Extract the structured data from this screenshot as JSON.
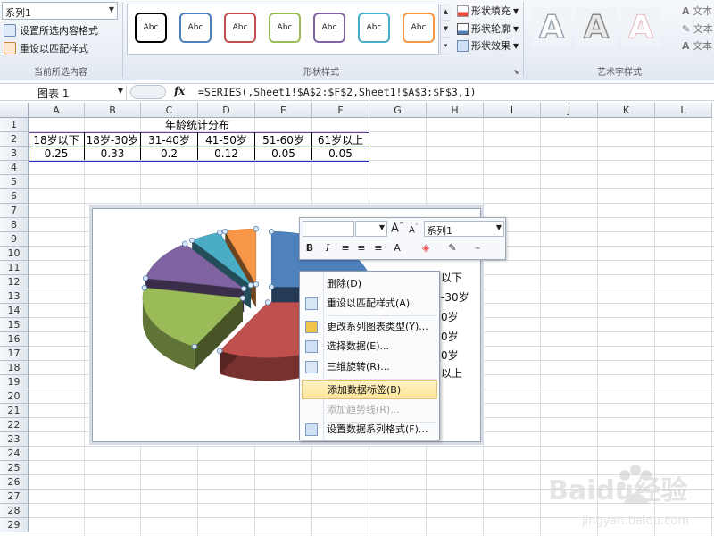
{
  "ribbon": {
    "series_select": "系列1",
    "cmd_format_selection": "设置所选内容格式",
    "cmd_reset_style": "重设以匹配样式",
    "group_current_selection": "当前所选内容",
    "group_shape_styles": "形状样式",
    "group_wordart_styles": "艺术字样式",
    "swatch_label": "Abc",
    "swatches": [
      "#000000",
      "#4f81bd",
      "#c0504d",
      "#9bbb59",
      "#8064a2",
      "#4bacc6",
      "#f79646"
    ],
    "shape_fill": "形状填充",
    "shape_outline": "形状轮廓",
    "shape_effects": "形状效果",
    "wordart_glyph": "A",
    "text_fill": "文本",
    "text_outline": "文本",
    "text_effects": "文本"
  },
  "formula_bar": {
    "name_box": "图表 1",
    "fx": "fx",
    "formula": "=SERIES(,Sheet1!$A$2:$F$2,Sheet1!$A$3:$F$3,1)"
  },
  "sheet": {
    "columns": [
      "A",
      "B",
      "C",
      "D",
      "E",
      "F",
      "G",
      "H",
      "I",
      "J",
      "K",
      "L"
    ],
    "rows": [
      "1",
      "2",
      "3",
      "4",
      "5",
      "6",
      "7",
      "8",
      "9",
      "10",
      "11",
      "12",
      "13",
      "14",
      "15",
      "16",
      "17",
      "18",
      "19",
      "20",
      "21",
      "22",
      "23",
      "24",
      "25",
      "26",
      "27",
      "28",
      "29"
    ],
    "title": "年龄统计分布",
    "headers": [
      "18岁以下",
      "18岁-30岁",
      "31-40岁",
      "41-50岁",
      "51-60岁",
      "61岁以上"
    ],
    "values": [
      "0.25",
      "0.33",
      "0.2",
      "0.12",
      "0.05",
      "0.05"
    ]
  },
  "chart": {
    "slices": [
      {
        "label": "18岁以下",
        "value": 0.25,
        "color": "#4f81bd"
      },
      {
        "label": "18岁-30岁",
        "value": 0.33,
        "color": "#c0504d"
      },
      {
        "label": "31-40岁",
        "value": 0.2,
        "color": "#9bbb59"
      },
      {
        "label": "41-50岁",
        "value": 0.12,
        "color": "#8064a2"
      },
      {
        "label": "51-60岁",
        "value": 0.05,
        "color": "#4bacc6"
      },
      {
        "label": "61岁以上",
        "value": 0.05,
        "color": "#f79646"
      }
    ],
    "legend_fragments": [
      "以下",
      "-30岁",
      "0岁",
      "0岁",
      "0岁",
      "以上"
    ]
  },
  "chart_data": {
    "type": "pie",
    "title": "",
    "categories": [
      "18岁以下",
      "18岁-30岁",
      "31-40岁",
      "41-50岁",
      "51-60岁",
      "61岁以上"
    ],
    "values": [
      0.25,
      0.33,
      0.2,
      0.12,
      0.05,
      0.05
    ],
    "legend": "right"
  },
  "mini_toolbar": {
    "font": "",
    "size": "",
    "series": "系列1",
    "grow": "A",
    "shrink": "A",
    "bold": "B",
    "italic": "I",
    "font_color": "A"
  },
  "context_menu": {
    "items": [
      {
        "label": "删除(D)",
        "icon": "delete-icon",
        "enabled": true
      },
      {
        "label": "重设以匹配样式(A)",
        "icon": "reset-style-icon",
        "enabled": true
      },
      {
        "label": "更改系列图表类型(Y)...",
        "icon": "chart-type-icon",
        "enabled": true
      },
      {
        "label": "选择数据(E)...",
        "icon": "select-data-icon",
        "enabled": true
      },
      {
        "label": "三维旋转(R)...",
        "icon": "3d-rotate-icon",
        "enabled": true
      },
      {
        "label": "添加数据标签(B)",
        "icon": "",
        "enabled": true,
        "highlighted": true
      },
      {
        "label": "添加趋势线(R)...",
        "icon": "",
        "enabled": false
      },
      {
        "label": "设置数据系列格式(F)...",
        "icon": "format-series-icon",
        "enabled": true
      }
    ]
  },
  "watermark": {
    "brand": "Baidu经验",
    "url": "jingyan.baidu.com"
  }
}
